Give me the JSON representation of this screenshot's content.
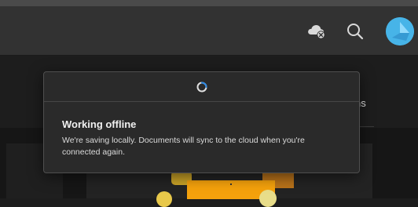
{
  "header": {
    "icons": {
      "cloud": "cloud-offline-icon",
      "search": "search-icon",
      "avatar": "user-avatar"
    },
    "avatar_color": "#4ab3e6"
  },
  "nav": {
    "tab_fragment": "ns"
  },
  "dialog": {
    "status_icon": "loading-spinner-icon",
    "title": "Working offline",
    "message": "We're saving locally. Documents will sync to the cloud when you're connected again.",
    "accent_color": "#2d8ae6"
  },
  "colors": {
    "header_bg": "#323232",
    "page_bg": "#1d1d1d",
    "dialog_bg": "#2a2a2a",
    "thumbnail_orange": "#f4a10c"
  }
}
